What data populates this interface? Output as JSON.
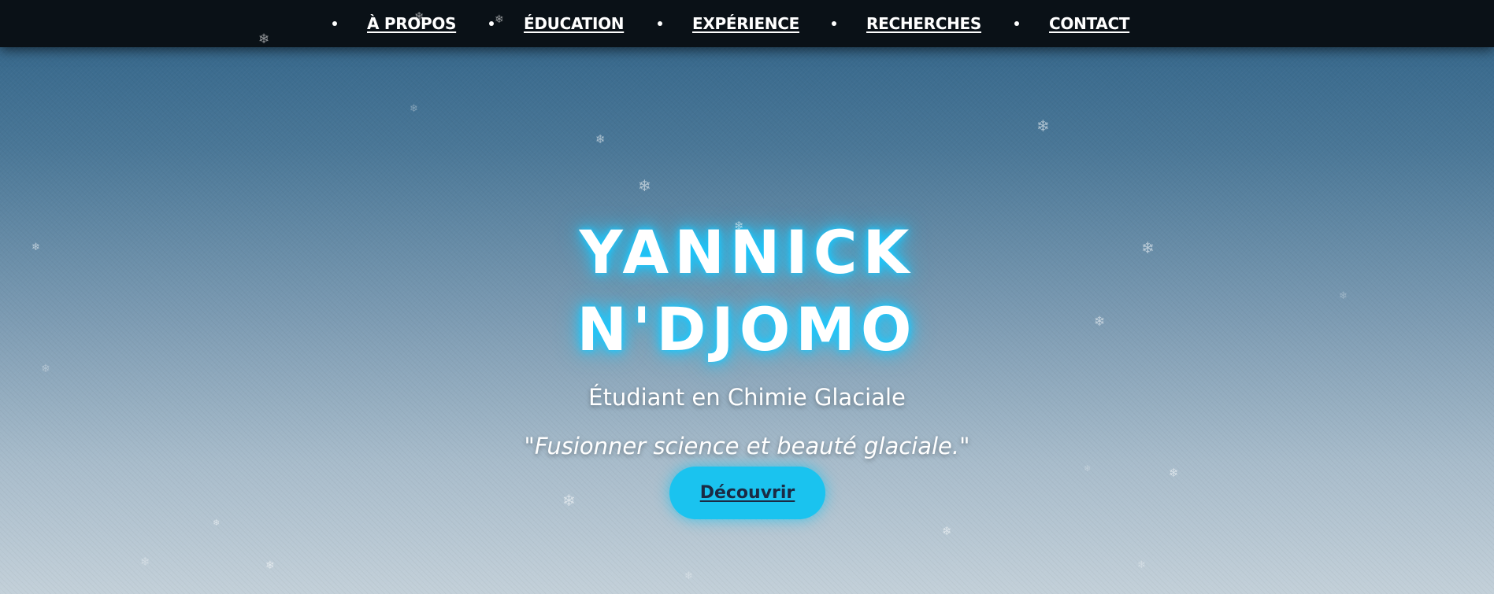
{
  "nav": {
    "items": [
      {
        "label": "À PROPOS"
      },
      {
        "label": "ÉDUCATION"
      },
      {
        "label": "EXPÉRIENCE"
      },
      {
        "label": "RECHERCHES"
      },
      {
        "label": "CONTACT"
      }
    ]
  },
  "hero": {
    "name_line1": "YANNICK",
    "name_line2": "N'DJOMO",
    "subtitle": "Étudiant en Chimie Glaciale",
    "quote": "\"Fusionner science et beauté glaciale.\"",
    "button_label": "Découvrir"
  },
  "decor": {
    "snowflake_glyph": "❄",
    "icon": "snowflake-icon"
  },
  "colors": {
    "nav_background": "#0a1117",
    "accent_glow": "#19c9ff",
    "button_background": "#1ac3ef",
    "button_text": "#1b2b44",
    "background_top": "#2f6287",
    "background_bottom": "#c3d0d9"
  }
}
